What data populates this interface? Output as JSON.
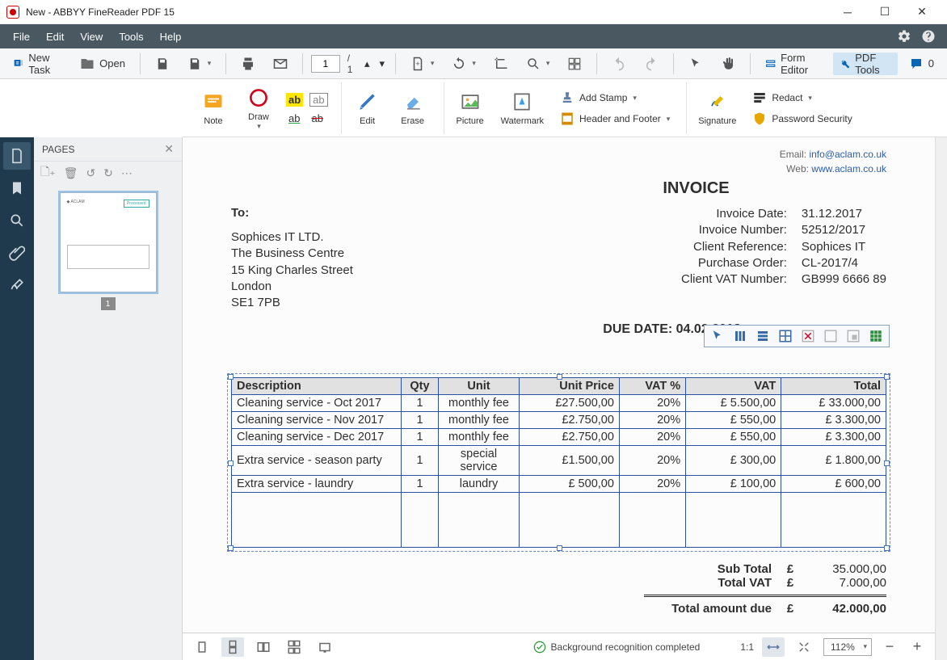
{
  "window": {
    "title": "New - ABBYY FineReader PDF 15"
  },
  "menubar": {
    "items": [
      "File",
      "Edit",
      "View",
      "Tools",
      "Help"
    ]
  },
  "toolbar": {
    "new_task": "New Task",
    "open": "Open",
    "page_current": "1",
    "page_total": "/ 1",
    "form_editor": "Form Editor",
    "pdf_tools": "PDF Tools",
    "comment_count": "0"
  },
  "ribbon": {
    "note": "Note",
    "draw": "Draw",
    "edit": "Edit",
    "erase": "Erase",
    "picture": "Picture",
    "watermark": "Watermark",
    "signature": "Signature",
    "add_stamp": "Add Stamp",
    "header_footer": "Header and Footer",
    "redact": "Redact",
    "password": "Password Security"
  },
  "pages_panel": {
    "title": "PAGES",
    "thumb_number": "1"
  },
  "document": {
    "email_label": "Email:",
    "email": "info@aclam.co.uk",
    "web_label": "Web:",
    "web": "www.aclam.co.uk",
    "invoice_title": "INVOICE",
    "to_label": "To:",
    "address": [
      "Sophices IT LTD.",
      "The Business Centre",
      "15 King Charles Street",
      "London",
      "SE1 7PB"
    ],
    "info": [
      {
        "k": "Invoice Date:",
        "v": "31.12.2017"
      },
      {
        "k": "Invoice Number:",
        "v": "52512/2017"
      },
      {
        "k": "Client Reference:",
        "v": "Sophices IT"
      },
      {
        "k": "Purchase Order:",
        "v": "CL-2017/4"
      },
      {
        "k": "Client VAT Number:",
        "v": "GB999 6666 89"
      }
    ],
    "due_label": "DUE DATE:",
    "due_date": "04.02.2018",
    "table": {
      "headers": [
        "Description",
        "Qty",
        "Unit",
        "Unit Price",
        "VAT %",
        "VAT",
        "Total"
      ],
      "rows": [
        [
          "Cleaning service - Oct 2017",
          "1",
          "monthly fee",
          "£27.500,00",
          "20%",
          "£  5.500,00",
          "£    33.000,00"
        ],
        [
          "Cleaning service - Nov 2017",
          "1",
          "monthly fee",
          "£2.750,00",
          "20%",
          "£     550,00",
          "£      3.300,00"
        ],
        [
          "Cleaning service - Dec 2017",
          "1",
          "monthly fee",
          "£2.750,00",
          "20%",
          "£     550,00",
          "£      3.300,00"
        ],
        [
          "Extra service - season party",
          "1",
          "special service",
          "£1.500,00",
          "20%",
          "£     300,00",
          "£      1.800,00"
        ],
        [
          "Extra service - laundry",
          "1",
          "laundry",
          "£     500,00",
          "20%",
          "£     100,00",
          "£         600,00"
        ]
      ]
    },
    "totals": {
      "subtotal_label": "Sub Total",
      "subtotal_cur": "£",
      "subtotal": "35.000,00",
      "vat_label": "Total VAT",
      "vat_cur": "£",
      "vat": "7.000,00",
      "grand_label": "Total amount due",
      "grand_cur": "£",
      "grand": "42.000,00"
    }
  },
  "statusbar": {
    "recognition": "Background recognition completed",
    "one_to_one": "1:1",
    "zoom": "112%"
  }
}
